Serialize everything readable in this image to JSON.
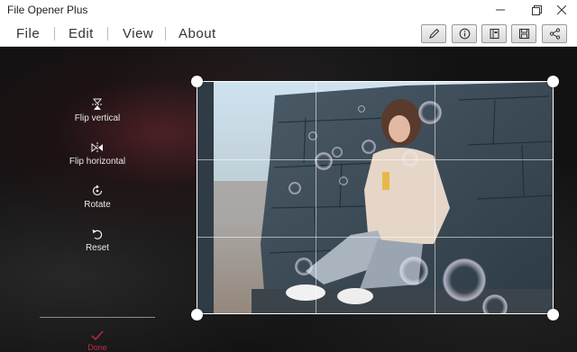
{
  "window": {
    "title": "File Opener Plus"
  },
  "menu": {
    "items": [
      "File",
      "Edit",
      "View",
      "About"
    ]
  },
  "toolbar": {
    "buttons": [
      "pencil-icon",
      "info-icon",
      "open-book-icon",
      "save-icon",
      "share-icon"
    ]
  },
  "editor": {
    "flip_vertical": "Flip vertical",
    "flip_horizontal": "Flip horizontal",
    "rotate": "Rotate",
    "reset": "Reset",
    "done": "Done"
  },
  "colors": {
    "accent": "#c8264a",
    "titlebar": "#ffffff",
    "workspace": "#121212"
  }
}
